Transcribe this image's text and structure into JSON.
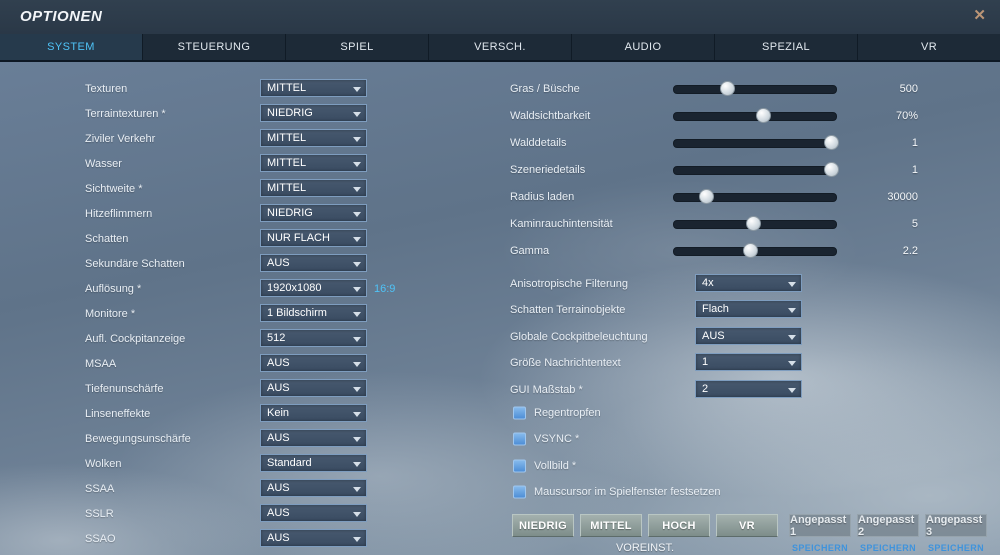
{
  "window": {
    "title": "OPTIONEN",
    "close_glyph": "✕"
  },
  "tabs": [
    {
      "label": "SYSTEM",
      "active": true
    },
    {
      "label": "STEUERUNG",
      "active": false
    },
    {
      "label": "SPIEL",
      "active": false
    },
    {
      "label": "VERSCH.",
      "active": false
    },
    {
      "label": "AUDIO",
      "active": false
    },
    {
      "label": "SPEZIAL",
      "active": false
    },
    {
      "label": "VR",
      "active": false
    }
  ],
  "left_column": {
    "rows": [
      {
        "label": "Texturen",
        "value": "MITTEL"
      },
      {
        "label": "Terraintexturen *",
        "value": "NIEDRIG"
      },
      {
        "label": "Ziviler Verkehr",
        "value": "MITTEL"
      },
      {
        "label": "Wasser",
        "value": "MITTEL"
      },
      {
        "label": "Sichtweite *",
        "value": "MITTEL"
      },
      {
        "label": "Hitzeflimmern",
        "value": "NIEDRIG"
      },
      {
        "label": "Schatten",
        "value": "NUR FLACH"
      },
      {
        "label": "Sekundäre Schatten",
        "value": "AUS"
      },
      {
        "label": "Auflösung *",
        "value": "1920x1080",
        "extra": "16:9"
      },
      {
        "label": "Monitore *",
        "value": "1 Bildschirm"
      },
      {
        "label": "Aufl. Cockpitanzeige",
        "value": "512"
      },
      {
        "label": "MSAA",
        "value": "AUS"
      },
      {
        "label": "Tiefenunschärfe",
        "value": "AUS"
      },
      {
        "label": "Linseneffekte",
        "value": "Kein"
      },
      {
        "label": "Bewegungsunschärfe",
        "value": "AUS"
      },
      {
        "label": "Wolken",
        "value": "Standard"
      },
      {
        "label": "SSAA",
        "value": "AUS"
      },
      {
        "label": "SSLR",
        "value": "AUS"
      },
      {
        "label": "SSAO",
        "value": "AUS"
      }
    ]
  },
  "right_column": {
    "sliders": [
      {
        "label": "Gras / Büsche",
        "value": "500",
        "percent": 33
      },
      {
        "label": "Waldsichtbarkeit",
        "value": "70%",
        "percent": 55
      },
      {
        "label": "Walddetails",
        "value": "1",
        "percent": 97
      },
      {
        "label": "Szeneriedetails",
        "value": "1",
        "percent": 97
      },
      {
        "label": "Radius laden",
        "value": "30000",
        "percent": 20
      },
      {
        "label": "Kaminrauchintensität",
        "value": "5",
        "percent": 49
      },
      {
        "label": "Gamma",
        "value": "2.2",
        "percent": 47
      }
    ],
    "dropdowns": [
      {
        "label": "Anisotropische Filterung",
        "value": "4x"
      },
      {
        "label": "Schatten Terrainobjekte",
        "value": "Flach"
      },
      {
        "label": "Globale Cockpitbeleuchtung",
        "value": "AUS"
      },
      {
        "label": "Größe Nachrichtentext",
        "value": "1"
      },
      {
        "label": "GUI Maßstab *",
        "value": "2"
      }
    ],
    "checkboxes": [
      {
        "label": "Regentropfen",
        "checked": false
      },
      {
        "label": "VSYNC *",
        "checked": false
      },
      {
        "label": "Vollbild *",
        "checked": false
      },
      {
        "label": "Mauscursor im Spielfenster festsetzen",
        "checked": false
      }
    ]
  },
  "footer": {
    "preset_buttons": [
      "NIEDRIG",
      "MITTEL",
      "HOCH",
      "VR"
    ],
    "preset_caption": "VOREINST.",
    "custom_buttons": [
      {
        "label": "Angepasst 1",
        "save_label": "SPEICHERN"
      },
      {
        "label": "Angepasst 2",
        "save_label": "SPEICHERN"
      },
      {
        "label": "Angepasst 3",
        "save_label": "SPEICHERN"
      }
    ]
  },
  "colors": {
    "accent_cyan": "#4fc3f7",
    "save_link": "#3f93dc",
    "checkbox_blue": "#5a9ae0",
    "titlebar_bg": "#2d3a49",
    "tabbar_bg": "#1d2a37",
    "dropdown_bg": "#3f5167",
    "dropdown_border": "#7e9dbf"
  }
}
